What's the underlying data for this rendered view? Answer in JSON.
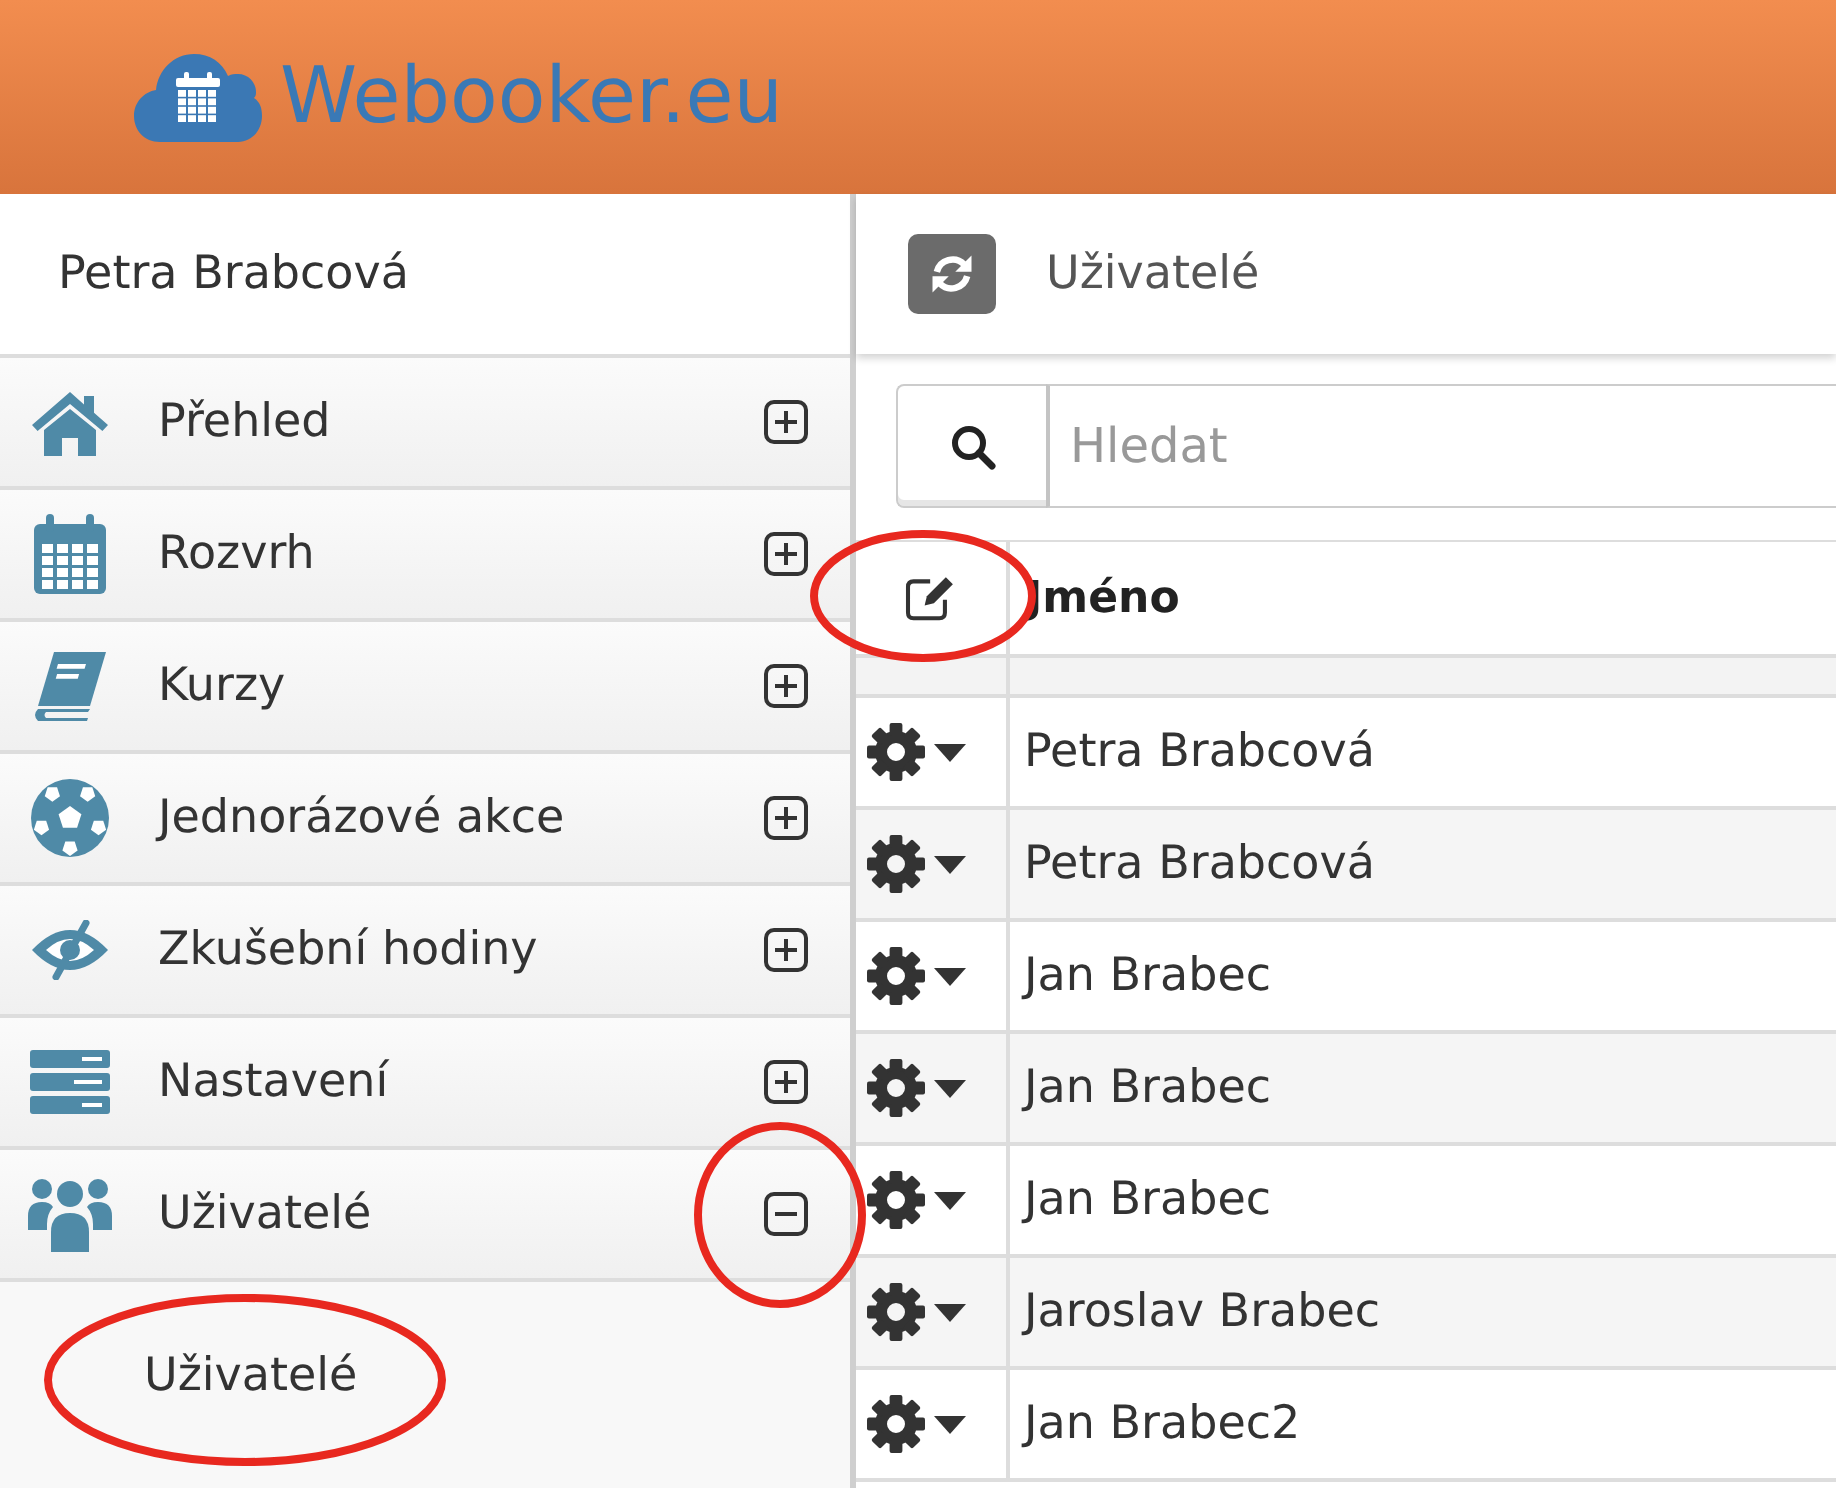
{
  "header": {
    "logo_text": "Webooker.eu"
  },
  "sidebar": {
    "user_name": "Petra Brabcová",
    "items": [
      {
        "label": "Přehled",
        "expanded": false,
        "toggle_circled": false
      },
      {
        "label": "Rozvrh",
        "expanded": false,
        "toggle_circled": false
      },
      {
        "label": "Kurzy",
        "expanded": false,
        "toggle_circled": false
      },
      {
        "label": "Jednorázové akce",
        "expanded": false,
        "toggle_circled": false
      },
      {
        "label": "Zkušební hodiny",
        "expanded": false,
        "toggle_circled": false
      },
      {
        "label": "Nastavení",
        "expanded": false,
        "toggle_circled": false
      },
      {
        "label": "Uživatelé",
        "expanded": true,
        "toggle_circled": true,
        "children": [
          {
            "label": "Uživatelé",
            "circled": true
          }
        ]
      }
    ]
  },
  "main": {
    "title": "Uživatelé",
    "search": {
      "placeholder": "Hledat"
    },
    "table": {
      "edit_column_circled": true,
      "columns": [
        {
          "label": "Jméno"
        }
      ],
      "rows": [
        {
          "name": "Petra Brabcová"
        },
        {
          "name": "Petra Brabcová"
        },
        {
          "name": "Jan Brabec"
        },
        {
          "name": "Jan Brabec"
        },
        {
          "name": "Jan Brabec"
        },
        {
          "name": "Jaroslav Brabec"
        },
        {
          "name": "Jan Brabec2"
        }
      ]
    }
  }
}
